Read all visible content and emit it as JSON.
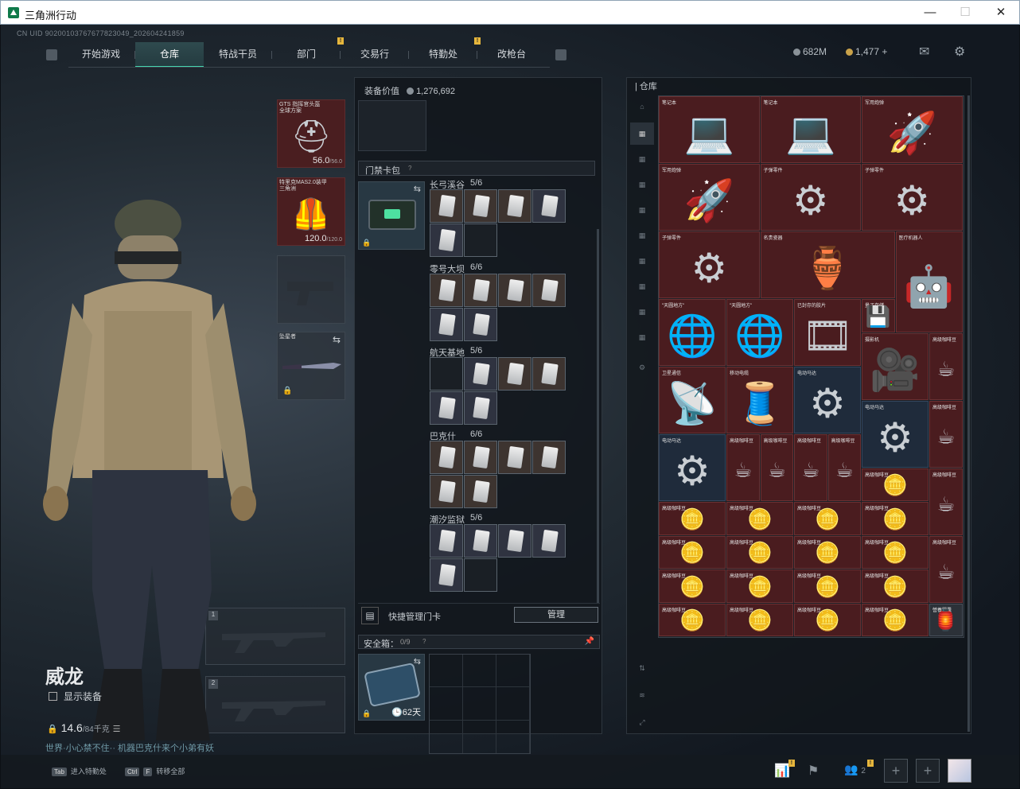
{
  "window": {
    "title": "三角洲行动",
    "minimize": "—",
    "maximize": "☐",
    "close": "✕"
  },
  "uid": "CN UID 90200103767677823049_202604241859",
  "nav": {
    "tabs": [
      {
        "label": "开始游戏"
      },
      {
        "label": "仓库",
        "active": true
      },
      {
        "label": "特战干员"
      },
      {
        "label": "部门"
      },
      {
        "label": "交易行"
      },
      {
        "label": "特勤处"
      },
      {
        "label": "改枪台"
      }
    ],
    "badge": "!"
  },
  "currency": {
    "hafcoin": "682M",
    "coupon": "1,477",
    "plus": "+"
  },
  "gear": {
    "helmet": {
      "name": "GTS 指挥官头盔 全球方案",
      "durability": "56.0",
      "max": "/56.0"
    },
    "armor": {
      "name": "特里克MAS2.0装甲 三角洲",
      "durability": "120.0",
      "max": "/120.0"
    },
    "melee": {
      "name": "坠星者",
      "swap": "⇆"
    },
    "slot1": "1",
    "slot2": "2"
  },
  "operator": {
    "name": "威龙",
    "show_gear": "显示装备",
    "weight": "14.6",
    "weight_max": "/84千克",
    "motto": "世界·小心禁不住·· 机器巴克什来个小弟有妖"
  },
  "mid": {
    "equip_value_label": "装备价值",
    "equip_value": "1,276,692",
    "keycard_title": "门禁卡包",
    "maps": [
      {
        "name": "长弓溪谷",
        "count": "5/6"
      },
      {
        "name": "零号大坝",
        "count": "6/6"
      },
      {
        "name": "航天基地",
        "count": "5/6"
      },
      {
        "name": "巴克什",
        "count": "6/6"
      },
      {
        "name": "潮汐监狱",
        "count": "5/6"
      }
    ],
    "quick_manage": "快捷管理门卡",
    "manage_btn": "管理",
    "safebox_title": "安全箱：",
    "safebox_count": "0/9",
    "safebox_days": "62天"
  },
  "warehouse": {
    "title": "仓库",
    "items": [
      {
        "name": "笔记本",
        "icon": "💻",
        "t": "r"
      },
      {
        "name": "笔记本",
        "icon": "💻",
        "t": "r"
      },
      {
        "name": "军用炮弹",
        "icon": "🚀",
        "t": "r"
      },
      {
        "name": "军用炮弹",
        "icon": "🚀",
        "t": "r"
      },
      {
        "name": "子弹零件",
        "icon": "⚙",
        "t": "r"
      },
      {
        "name": "子弹零件",
        "icon": "⚙",
        "t": "r"
      },
      {
        "name": "子弹零件",
        "icon": "⚙",
        "t": "r"
      },
      {
        "name": "名贵瓷器",
        "icon": "🏺",
        "t": "r"
      },
      {
        "name": "医疗机器人",
        "icon": "🤖",
        "t": "r"
      },
      {
        "name": "\"天圆地方\"",
        "icon": "🌐",
        "t": "r"
      },
      {
        "name": "\"天圆地方\"",
        "icon": "🌐",
        "t": "r"
      },
      {
        "name": "已封存的胶片",
        "icon": "🎞",
        "t": "r"
      },
      {
        "name": "量子存储",
        "icon": "💾",
        "t": "r"
      },
      {
        "name": "摄影机",
        "icon": "🎥",
        "t": "r"
      },
      {
        "name": "高级咖啡豆",
        "icon": "☕",
        "t": "r"
      },
      {
        "name": "卫星通信",
        "icon": "📡",
        "t": "r"
      },
      {
        "name": "移动电缆",
        "icon": "🧵",
        "t": "r"
      },
      {
        "name": "电动马达",
        "icon": "⚙",
        "t": "b"
      },
      {
        "name": "电动马达",
        "icon": "⚙",
        "t": "b"
      },
      {
        "name": "高级咖啡豆",
        "icon": "☕",
        "t": "r"
      },
      {
        "name": "电动马达",
        "icon": "⚙",
        "t": "b"
      },
      {
        "name": "高级咖啡豆",
        "icon": "☕",
        "t": "r"
      },
      {
        "name": "高级咖啡豆",
        "icon": "☕",
        "t": "r"
      },
      {
        "name": "高级咖啡豆",
        "icon": "☕",
        "t": "r"
      },
      {
        "name": "高级咖啡豆",
        "icon": "☕",
        "t": "r"
      },
      {
        "name": "高级咖啡豆",
        "icon": "🪙",
        "t": "r"
      },
      {
        "name": "高级咖啡豆",
        "icon": "☕",
        "t": "r"
      },
      {
        "name": "高级咖啡豆",
        "icon": "🪙",
        "t": "r"
      },
      {
        "name": "高级咖啡豆",
        "icon": "🪙",
        "t": "r"
      },
      {
        "name": "高级咖啡豆",
        "icon": "🪙",
        "t": "r"
      },
      {
        "name": "高级咖啡豆",
        "icon": "🪙",
        "t": "r"
      },
      {
        "name": "高级咖啡豆",
        "icon": "☕",
        "t": "r"
      },
      {
        "name": "高级咖啡豆",
        "icon": "🪙",
        "t": "r"
      },
      {
        "name": "高级咖啡豆",
        "icon": "🪙",
        "t": "r"
      },
      {
        "name": "高级咖啡豆",
        "icon": "🪙",
        "t": "r"
      },
      {
        "name": "高级咖啡豆",
        "icon": "🪙",
        "t": "r"
      },
      {
        "name": "高级咖啡豆",
        "icon": "☕",
        "t": "r"
      },
      {
        "name": "高级咖啡豆",
        "icon": "🪙",
        "t": "r"
      },
      {
        "name": "高级咖啡豆",
        "icon": "🪙",
        "t": "r"
      },
      {
        "name": "高级咖啡豆",
        "icon": "🪙",
        "t": "r"
      },
      {
        "name": "高级咖啡豆",
        "icon": "🪙",
        "t": "r"
      },
      {
        "name": "高级咖啡豆",
        "icon": "☕",
        "t": "r"
      },
      {
        "name": "高级咖啡豆",
        "icon": "🪙",
        "t": "r"
      },
      {
        "name": "高级咖啡豆",
        "icon": "🪙",
        "t": "r"
      },
      {
        "name": "高级咖啡豆",
        "icon": "🪙",
        "t": "r"
      },
      {
        "name": "高级咖啡豆",
        "icon": "🪙",
        "t": "r"
      },
      {
        "name": "營養膠囊",
        "icon": "🏮",
        "t": "g"
      }
    ]
  },
  "bottom": {
    "tab_key": "Tab",
    "tab_label": "进入特勤处",
    "ctrl_key": "Ctrl",
    "f_key": "F",
    "f_label": "转移全部",
    "squad_count": "2",
    "plus": "+",
    "badge": "!"
  }
}
